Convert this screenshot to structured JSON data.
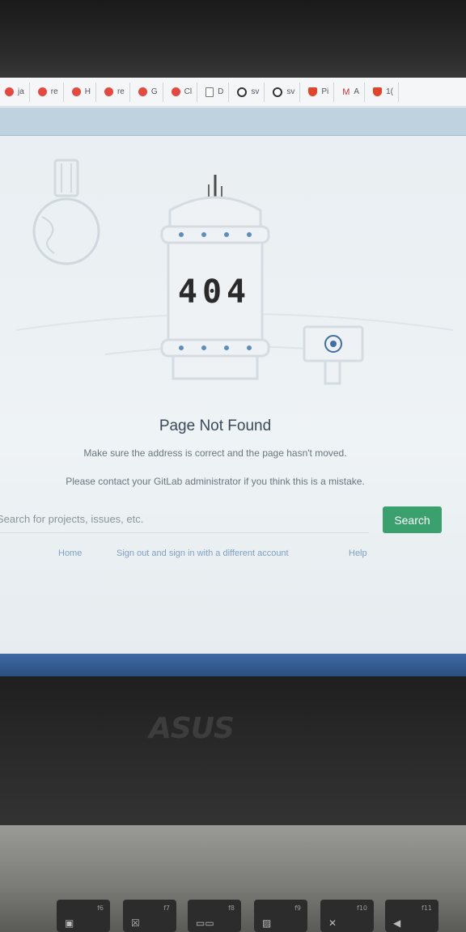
{
  "bookmarks": [
    {
      "label": "ja",
      "icon": "red-circle-icon"
    },
    {
      "label": "re",
      "icon": "red-circle-icon"
    },
    {
      "label": "H",
      "icon": "red-circle-icon"
    },
    {
      "label": "re",
      "icon": "red-circle-icon"
    },
    {
      "label": "G",
      "icon": "red-circle-icon"
    },
    {
      "label": "Cl",
      "icon": "red-circle-icon"
    },
    {
      "label": "D",
      "icon": "document-icon"
    },
    {
      "label": "sv",
      "icon": "github-icon"
    },
    {
      "label": "sv",
      "icon": "github-icon"
    },
    {
      "label": "Pi",
      "icon": "gitlab-icon"
    },
    {
      "label": "A",
      "icon": "gmail-icon"
    },
    {
      "label": "1(",
      "icon": "gitlab-icon"
    }
  ],
  "error": {
    "code": "404",
    "title": "Page Not Found",
    "line1": "Make sure the address is correct and the page hasn't moved.",
    "line2": "Please contact your GitLab administrator if you think this is a mistake."
  },
  "search": {
    "placeholder": "Search for projects, issues, etc.",
    "button_label": "Search"
  },
  "links": {
    "home": "Home",
    "sign_out": "Sign out and sign in with a different account",
    "help": "Help"
  },
  "laptop": {
    "brand": "ASUS",
    "keys": [
      "f6",
      "f7",
      "f8",
      "f9",
      "f10",
      "f11"
    ]
  },
  "colors": {
    "accent_green": "#3aa06e",
    "link_blue": "#7ea1c3",
    "taskbar_blue": "#3e6aa3"
  }
}
